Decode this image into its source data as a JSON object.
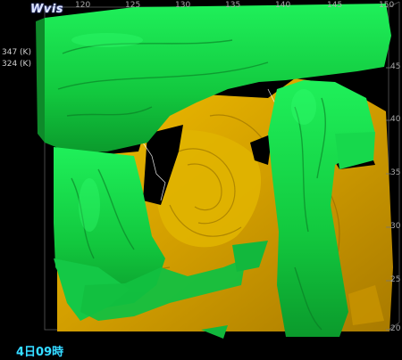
{
  "app": {
    "logo": "Wvis"
  },
  "isosurfaces": [
    {
      "label": "347 (K)",
      "color": "#19d64a"
    },
    {
      "label": "324 (K)",
      "color": "#d6a800"
    }
  ],
  "timestamp": "4日09時",
  "axes": {
    "longitude_ticks": [
      "120",
      "125",
      "130",
      "135",
      "140",
      "145",
      "150"
    ],
    "latitude_ticks": [
      "45",
      "40",
      "35",
      "30",
      "25",
      "20"
    ]
  },
  "colors": {
    "background": "#000000",
    "green_surface": "#19d64a",
    "yellow_surface": "#d6a800",
    "timestamp_text": "#35e0ff"
  }
}
